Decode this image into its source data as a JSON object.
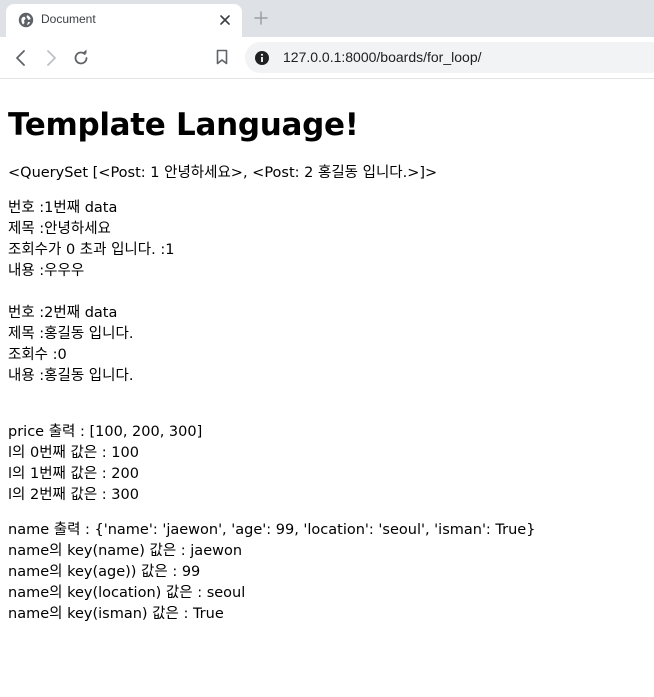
{
  "browser": {
    "tab_title": "Document",
    "url": "127.0.0.1:8000/boards/for_loop/"
  },
  "page": {
    "heading": "Template Language!",
    "queryset_line": "<QuerySet [<Post: 1 안녕하세요>, <Post: 2 홍길동 입니다.>]>",
    "posts": [
      {
        "number": "번호 :1번째 data",
        "title": "제목 :안녕하세요",
        "views": "조회수가 0 초과 입니다. :1",
        "content": "내용 :우우우"
      },
      {
        "number": "번호 :2번째 data",
        "title": "제목 :홍길동 입니다.",
        "views": "조회수 :0",
        "content": "내용 :홍길동 입니다."
      }
    ],
    "price": {
      "header": "price 출력 : [100, 200, 300]",
      "items": [
        "l의 0번째 값은 : 100",
        "l의 1번째 값은 : 200",
        "l의 2번째 값은 : 300"
      ]
    },
    "name": {
      "header": "name 출력 : {'name': 'jaewon', 'age': 99, 'location': 'seoul', 'isman': True}",
      "items": [
        "name의 key(name) 값은 : jaewon",
        "name의 key(age)) 값은 : 99",
        "name의 key(location) 값은 : seoul",
        "name의 key(isman) 값은 : True"
      ]
    }
  }
}
